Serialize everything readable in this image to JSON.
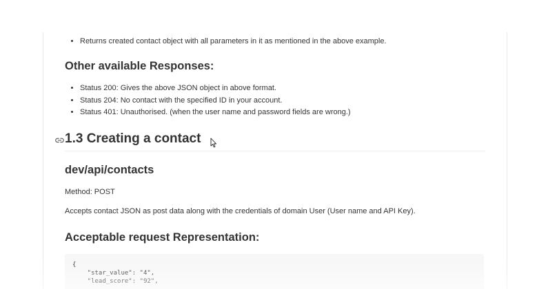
{
  "top_list": {
    "items": [
      "Returns created contact object with all parameters in it as mentioned in the above example."
    ]
  },
  "responses": {
    "heading": "Other available Responses:",
    "items": [
      "Status 200: Gives the above JSON object in above format.",
      "Status 204: No contact with the specified ID in your account.",
      "Status 401: Unauthorised. (when the user name and password fields are wrong.)"
    ]
  },
  "section": {
    "title": "1.3 Creating a contact",
    "anchor_icon": "link-icon"
  },
  "endpoint": {
    "path": "dev/api/contacts",
    "method": "Method: POST",
    "description": "Accepts contact JSON as post data along with the credentials of domain User (User name and API Key)."
  },
  "request": {
    "heading": "Acceptable request Representation:",
    "code_lines": [
      "{",
      "    \"star_value\": \"4\",",
      "    \"lead_score\": \"92\","
    ]
  },
  "cursor_icon": "mouse-cursor-icon"
}
